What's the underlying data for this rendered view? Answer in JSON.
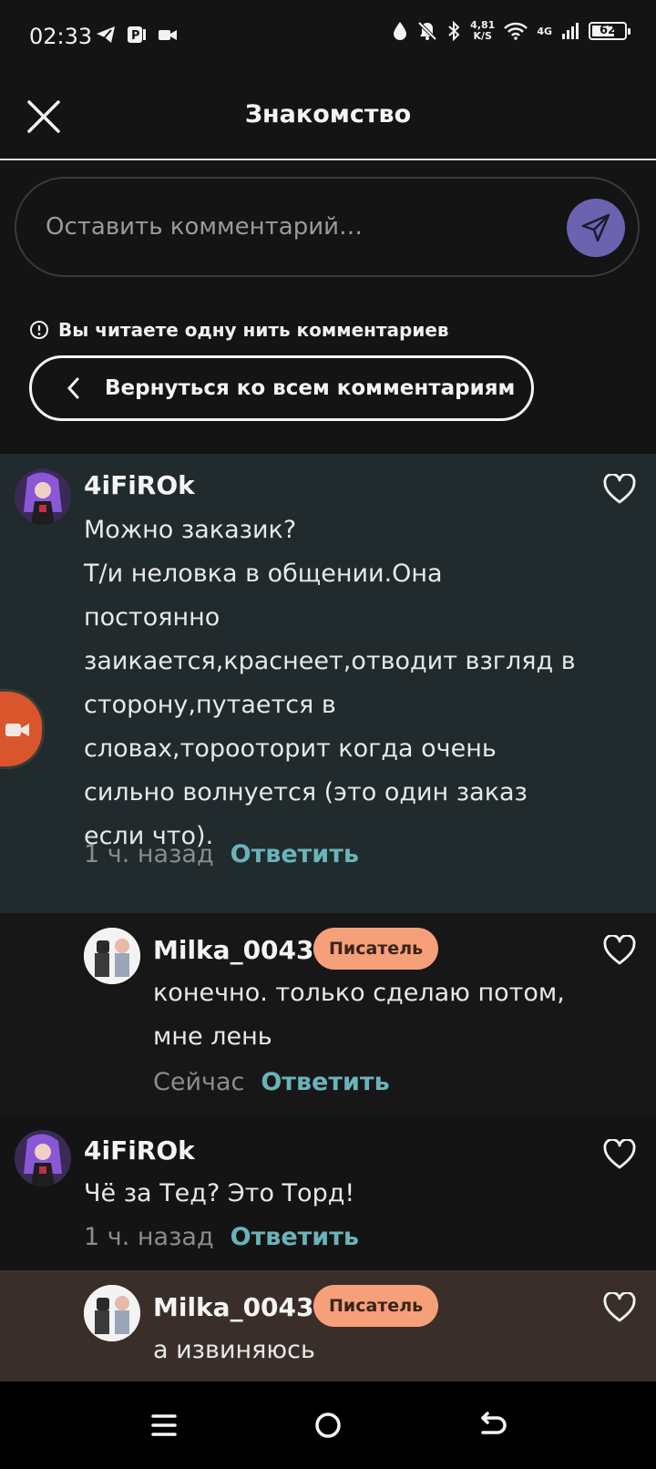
{
  "status_bar": {
    "time": "02:33",
    "left_icons": [
      "telegram-icon",
      "parking-icon",
      "video-camera-icon"
    ],
    "net_speed": "4,81",
    "net_speed_unit": "K/S",
    "network": "4G",
    "battery": "62"
  },
  "header": {
    "title": "Знакомство"
  },
  "composer": {
    "placeholder": "Оставить комментарий…"
  },
  "thread": {
    "notice": "Вы читаете одну нить комментариев",
    "back_label": "Вернуться ко всем комментариям"
  },
  "comments": [
    {
      "author": "4iFiROk",
      "text": "Можно заказик?\nТ/и неловка в общении.Она\nпостоянно\nзаикается,краснеет,отводит взгляд в\nсторону,путается в\nсловах,торооторит когда очень\nсильно волнуется (это один заказ\nесли что).",
      "time": "1 ч. назад",
      "reply": "Ответить"
    },
    {
      "author": "Milka_0043",
      "badge": "Писатель",
      "text": "конечно. только сделаю потом,\nмне лень",
      "time": "Сейчас",
      "reply": "Ответить"
    },
    {
      "author": "4iFiROk",
      "text": "Чё за Тед? Это Торд!",
      "time": "1 ч. назад",
      "reply": "Ответить"
    },
    {
      "author": "Milka_0043",
      "badge": "Писатель",
      "text": "а извиняюсь"
    }
  ],
  "colors": {
    "accent_send": "#6b62b0",
    "reply_link": "#6ab3ba",
    "badge": "#f6a07a",
    "highlight_comment": "#212a2c",
    "floating_button": "#d9562c"
  }
}
